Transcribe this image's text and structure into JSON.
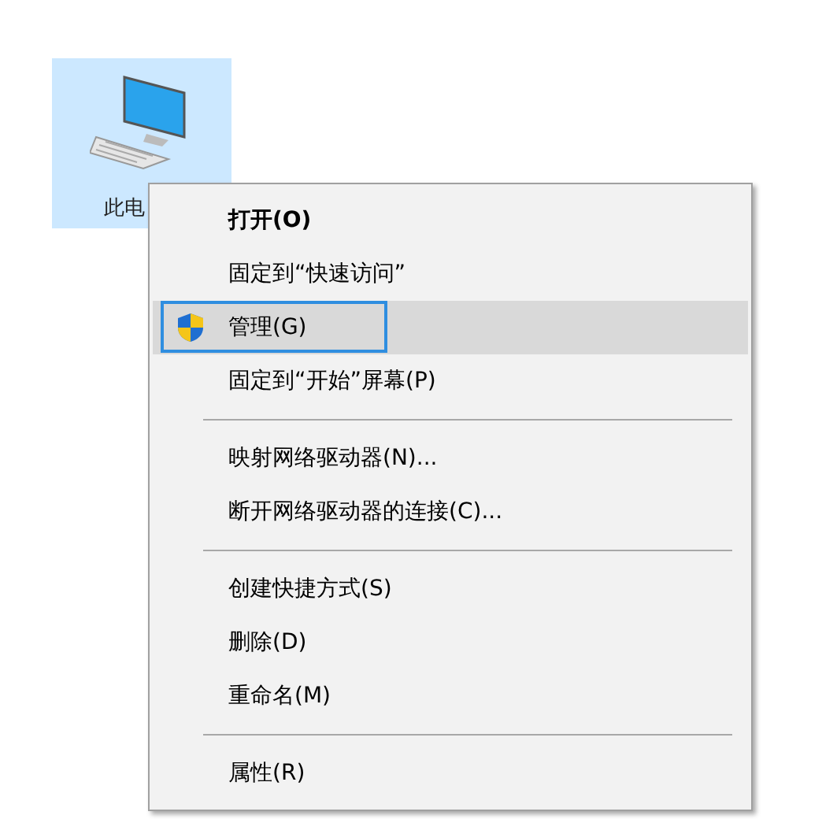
{
  "desktop_icon": {
    "label": "此电",
    "selected": true
  },
  "context_menu": {
    "items": [
      {
        "kind": "item",
        "label": "打开(O)",
        "default": true,
        "selected": false,
        "focused": false
      },
      {
        "kind": "item",
        "label": "固定到“快速访问”",
        "default": false,
        "selected": false,
        "focused": false
      },
      {
        "kind": "shield_item",
        "label": "管理(G)",
        "default": false,
        "selected": true,
        "focused": true
      },
      {
        "kind": "item",
        "label": "固定到“开始”屏幕(P)",
        "default": false,
        "selected": false,
        "focused": false
      },
      {
        "kind": "separator"
      },
      {
        "kind": "item",
        "label": "映射网络驱动器(N)...",
        "default": false,
        "selected": false,
        "focused": false
      },
      {
        "kind": "item",
        "label": "断开网络驱动器的连接(C)...",
        "default": false,
        "selected": false,
        "focused": false
      },
      {
        "kind": "separator"
      },
      {
        "kind": "item",
        "label": "创建快捷方式(S)",
        "default": false,
        "selected": false,
        "focused": false
      },
      {
        "kind": "item",
        "label": "删除(D)",
        "default": false,
        "selected": false,
        "focused": false
      },
      {
        "kind": "item",
        "label": "重命名(M)",
        "default": false,
        "selected": false,
        "focused": false
      },
      {
        "kind": "separator"
      },
      {
        "kind": "item",
        "label": "属性(R)",
        "default": false,
        "selected": false,
        "focused": false
      }
    ]
  }
}
